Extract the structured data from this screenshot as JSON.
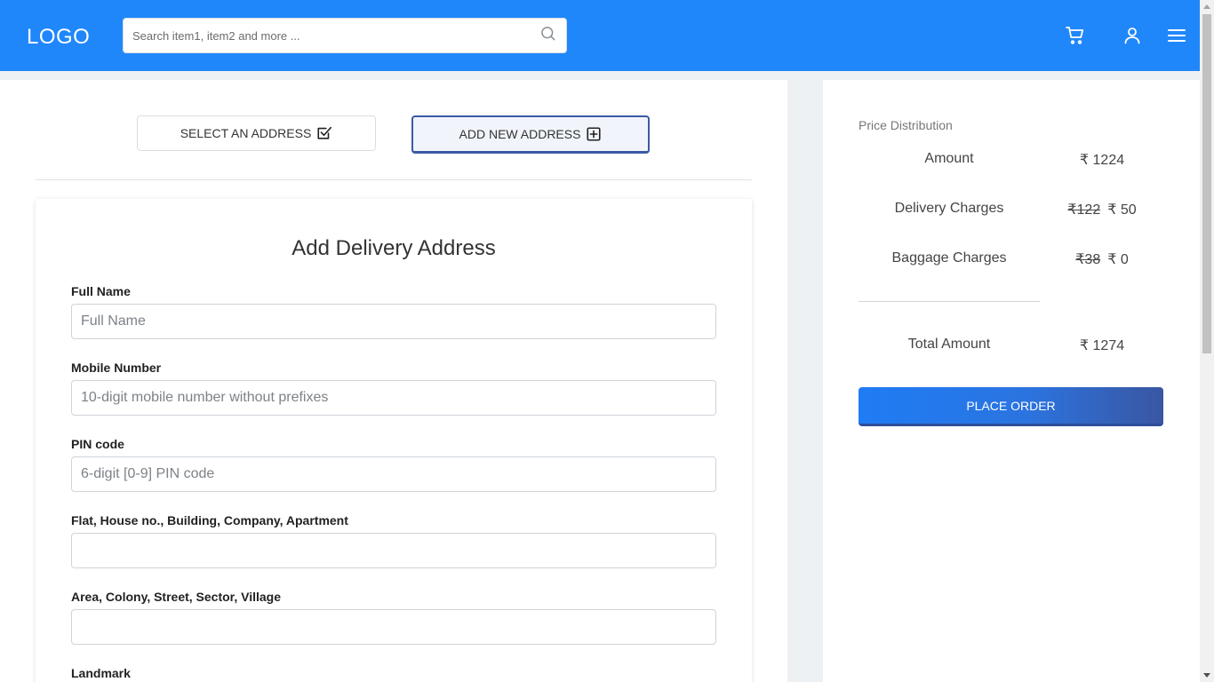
{
  "header": {
    "logo": "LOGO",
    "search_placeholder": "Search item1, item2 and more ...",
    "icons": [
      "search-icon",
      "cart-icon",
      "user-icon",
      "hamburger-menu-icon"
    ]
  },
  "address_tabs": {
    "select_label": "SELECT AN ADDRESS",
    "add_label": "ADD NEW ADDRESS",
    "active": "add"
  },
  "form": {
    "title": "Add Delivery Address",
    "fields": [
      {
        "label": "Full Name",
        "placeholder": "Full Name",
        "value": ""
      },
      {
        "label": "Mobile Number",
        "placeholder": "10-digit mobile number without prefixes",
        "value": ""
      },
      {
        "label": "PIN code",
        "placeholder": "6-digit [0-9] PIN code",
        "value": ""
      },
      {
        "label": "Flat, House no., Building, Company, Apartment",
        "placeholder": "",
        "value": ""
      },
      {
        "label": "Area, Colony, Street, Sector, Village",
        "placeholder": "",
        "value": ""
      },
      {
        "label": "Landmark",
        "placeholder": "",
        "value": ""
      }
    ]
  },
  "price": {
    "title": "Price Distribution",
    "rows": [
      {
        "label": "Amount",
        "original": "",
        "value": "₹ 1224"
      },
      {
        "label": "Delivery Charges",
        "original": "₹122",
        "value": "₹ 50"
      },
      {
        "label": "Baggage Charges",
        "original": "₹38",
        "value": "₹ 0"
      }
    ],
    "total_label": "Total Amount",
    "total_value": "₹ 1274",
    "place_order_label": "PLACE ORDER"
  },
  "colors": {
    "header_bg": "#1f87fa",
    "active_tab_border": "#3b5aa6",
    "place_order_gradient_start": "#1f7cf5",
    "place_order_gradient_end": "#3a56a2"
  }
}
